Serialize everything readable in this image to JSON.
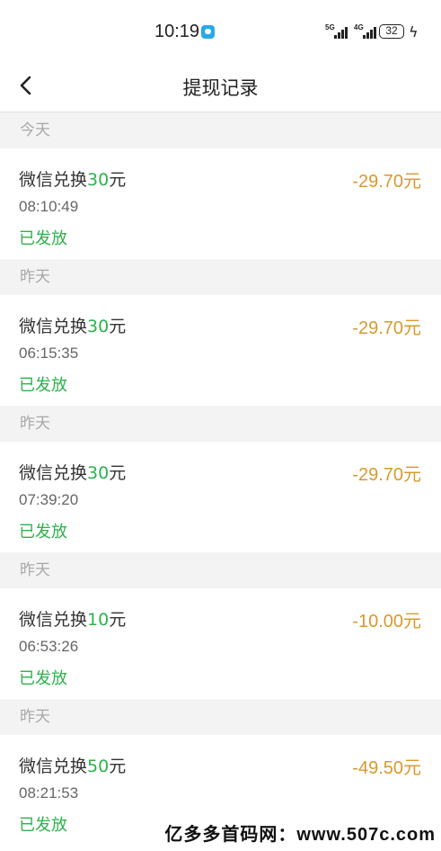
{
  "status_bar": {
    "time": "10:19",
    "net1": "5G",
    "net2": "4G",
    "battery": "32"
  },
  "nav": {
    "title": "提现记录"
  },
  "records": [
    {
      "section": "今天",
      "title_prefix": "微信兑换",
      "title_amount": "30",
      "title_suffix": "元",
      "time": "08:10:49",
      "status": "已发放",
      "amount": "-29.70元"
    },
    {
      "section": "昨天",
      "title_prefix": "微信兑换",
      "title_amount": "30",
      "title_suffix": "元",
      "time": "06:15:35",
      "status": "已发放",
      "amount": "-29.70元"
    },
    {
      "section": "昨天",
      "title_prefix": "微信兑换",
      "title_amount": "30",
      "title_suffix": "元",
      "time": "07:39:20",
      "status": "已发放",
      "amount": "-29.70元"
    },
    {
      "section": "昨天",
      "title_prefix": "微信兑换",
      "title_amount": "10",
      "title_suffix": "元",
      "time": "06:53:26",
      "status": "已发放",
      "amount": "-10.00元"
    },
    {
      "section": "昨天",
      "title_prefix": "微信兑换",
      "title_amount": "50",
      "title_suffix": "元",
      "time": "08:21:53",
      "status": "已发放",
      "amount": "-49.50元"
    }
  ],
  "watermark": "亿多多首码网：www.507c.com",
  "colors": {
    "green": "#2bb24c",
    "orange": "#d79a2d",
    "section_bg": "#f3f3f3"
  }
}
